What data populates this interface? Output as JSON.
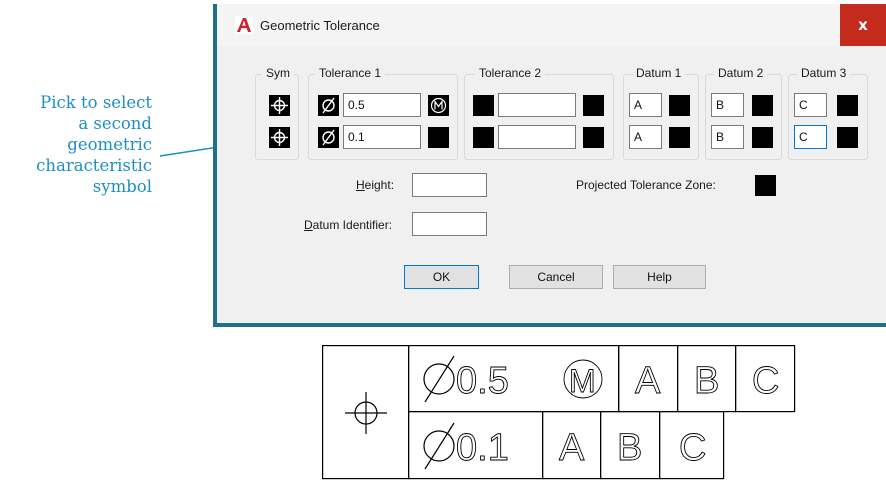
{
  "callout": {
    "lines": [
      "Pick to select",
      "a second",
      "geometric",
      "characteristic",
      "symbol"
    ]
  },
  "dialog": {
    "title": "Geometric Tolerance",
    "close_label": "x",
    "groups": {
      "sym": "Sym",
      "tol1": "Tolerance 1",
      "tol2": "Tolerance 2",
      "datum1": "Datum 1",
      "datum2": "Datum 2",
      "datum3": "Datum 3"
    },
    "row1": {
      "tol1_value": "0.5",
      "tol2_value": "",
      "datum1": "A",
      "datum2": "B",
      "datum3": "C"
    },
    "row2": {
      "tol1_value": "0.1",
      "tol2_value": "",
      "datum1": "A",
      "datum2": "B",
      "datum3": "C"
    },
    "height_label_u": "H",
    "height_label_rest": "eight:",
    "height_value": "",
    "datum_id_label_u": "D",
    "datum_id_label_rest": "atum Identifier:",
    "datum_id_value": "",
    "projected_label": "Projected Tolerance Zone:",
    "ok": "OK",
    "cancel": "Cancel",
    "help": "Help"
  },
  "frame": {
    "row1": {
      "tolerance": "0.5",
      "modifier": "M",
      "datums": [
        "A",
        "B",
        "C"
      ]
    },
    "row2": {
      "tolerance": "0.1",
      "datums": [
        "A",
        "B",
        "C"
      ]
    }
  },
  "icons": {
    "position_symbol": "position-icon",
    "diameter_symbol": "diameter-icon",
    "mmc_symbol": "circled-m-icon"
  }
}
